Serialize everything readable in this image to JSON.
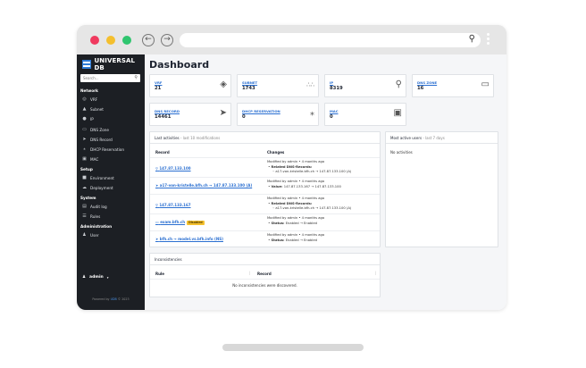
{
  "sidebar": {
    "brand": "UNIVERSAL DB",
    "search_placeholder": "Search...",
    "sections": [
      {
        "label": "Network",
        "items": [
          {
            "label": "VRF",
            "icon": "target-icon"
          },
          {
            "label": "Subnet",
            "icon": "network-icon"
          },
          {
            "label": "IP",
            "icon": "pin-icon"
          },
          {
            "label": "DNS Zone",
            "icon": "folder-icon"
          },
          {
            "label": "DNS Record",
            "icon": "sign-icon"
          },
          {
            "label": "DHCP Reservation",
            "icon": "pushpin-icon"
          },
          {
            "label": "MAC",
            "icon": "chip-icon"
          }
        ]
      },
      {
        "label": "Setup",
        "items": [
          {
            "label": "Environment",
            "icon": "box-icon"
          },
          {
            "label": "Deployment",
            "icon": "cloud-icon"
          }
        ]
      },
      {
        "label": "System",
        "items": [
          {
            "label": "Audit log",
            "icon": "list-icon"
          },
          {
            "label": "Rules",
            "icon": "rules-icon"
          }
        ]
      },
      {
        "label": "Administration",
        "items": [
          {
            "label": "User",
            "icon": "user-icon"
          }
        ]
      }
    ],
    "user_label": "admin",
    "footer_prefix": "Powered by",
    "footer_link": "UDB",
    "footer_suffix": "© 2023"
  },
  "main": {
    "title": "Dashboard",
    "stats_row1": [
      {
        "label": "VRF",
        "value": "21",
        "icon": "layers-icon"
      },
      {
        "label": "SUBNET",
        "value": "1743",
        "icon": "network-icon"
      },
      {
        "label": "IP",
        "value": "8319",
        "icon": "pin-icon"
      },
      {
        "label": "DNS ZONE",
        "value": "16",
        "icon": "folder-icon"
      }
    ],
    "stats_row2": [
      {
        "label": "DNS RECORD",
        "value": "14461",
        "icon": "sign-icon"
      },
      {
        "label": "DHCP RESERVATION",
        "value": "0",
        "icon": "pushpin-icon"
      },
      {
        "label": "MAC",
        "value": "0",
        "icon": "chip-icon"
      }
    ],
    "activities": {
      "title": "Last activities",
      "subtitle": "- last 10 modifications",
      "col_record": "Record",
      "col_changes": "Changes",
      "rows": [
        {
          "record": "147.87.133.100",
          "badge": "",
          "line1": "Modified by admin • 4 months ago",
          "line2_bold": "Related DNS-Records:",
          "line3": "◦ a17-von-kristelle.bfh.ch → 147.87.133.100 (A)"
        },
        {
          "record": "a17-von-kristelle.bfh.ch → 147.87.133.100 (A)",
          "badge": "",
          "line1": "Modified by admin • 4 months ago",
          "line2_bold": "Value:",
          "line3": "147.87.133.167 → 147.87.133.100"
        },
        {
          "record": "147.87.133.167",
          "badge": "",
          "line1": "Modified by admin • 4 months ago",
          "line2_bold": "Related DNS-Records:",
          "line3": "◦ a17-von-kristelle.bfh.ch → 147.87.133.100 (A)"
        },
        {
          "record": "exam.bfh.ch",
          "badge": "Disabled",
          "line1": "Modified by admin • 4 months ago",
          "line2_bold": "Status:",
          "line3": "Enabled → Enabled"
        },
        {
          "record": "bfh.ch → model.vs.bfh.info (NS)",
          "badge": "",
          "line1": "Modified by admin • 4 months ago",
          "line2_bold": "Status:",
          "line3": "Enabled → Enabled"
        }
      ]
    },
    "active_users": {
      "title": "Most active users",
      "subtitle": "- last 7 days",
      "empty": "No activities"
    },
    "inconsistencies": {
      "title": "Inconsistencies",
      "col_rule": "Rule",
      "col_record": "Record",
      "empty": "No inconsistencies were discovered."
    }
  }
}
